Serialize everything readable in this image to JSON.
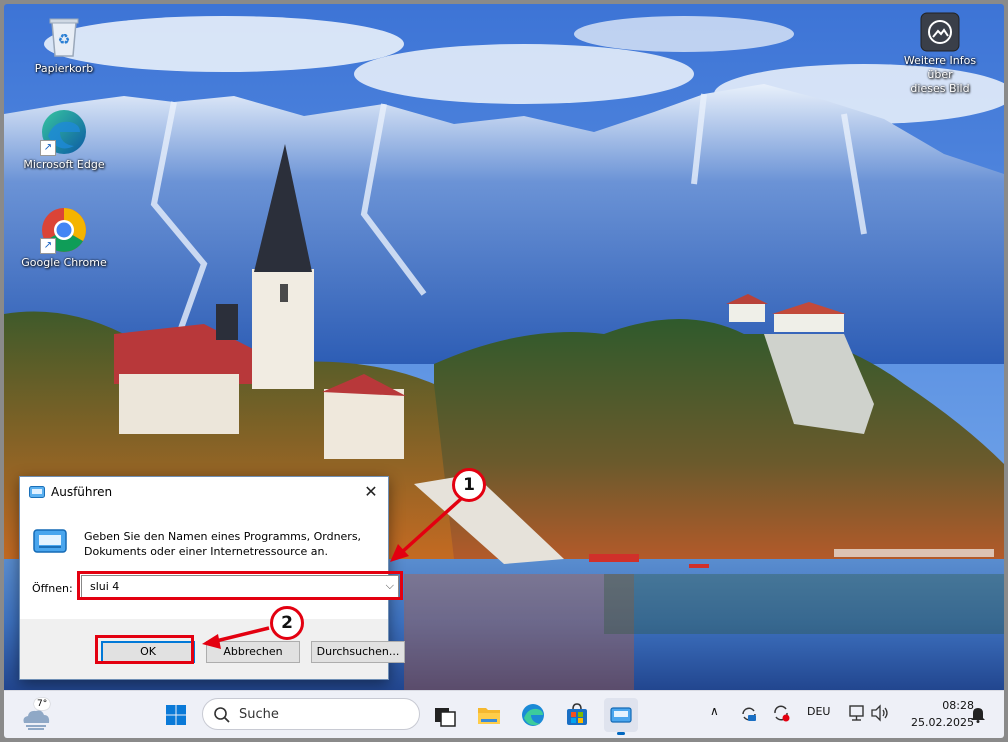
{
  "desktop": {
    "icons": [
      {
        "label": "Papierkorb"
      },
      {
        "label": "Microsoft Edge"
      },
      {
        "label": "Google Chrome"
      }
    ],
    "info_icon": {
      "label_line1": "Weitere Infos über",
      "label_line2": "dieses Bild"
    }
  },
  "run_dialog": {
    "title": "Ausführen",
    "close_glyph": "✕",
    "description_line1": "Geben Sie den Namen eines Programms, Ordners,",
    "description_line2": "Dokuments oder einer Internetressource an.",
    "open_label": "Öffnen:",
    "open_value": "slui 4",
    "dropdown_glyph": "⌵",
    "ok_label": "OK",
    "cancel_label": "Abbrechen",
    "browse_label": "Durchsuchen..."
  },
  "annotations": {
    "step1": "1",
    "step2": "2",
    "highlight_color": "#e30010"
  },
  "taskbar": {
    "weather_temp": "7°",
    "search_placeholder": "Suche",
    "tray": {
      "chevron": "∧",
      "language": "DEU"
    },
    "clock": {
      "time": "08:28",
      "date": "25.02.2025"
    }
  }
}
